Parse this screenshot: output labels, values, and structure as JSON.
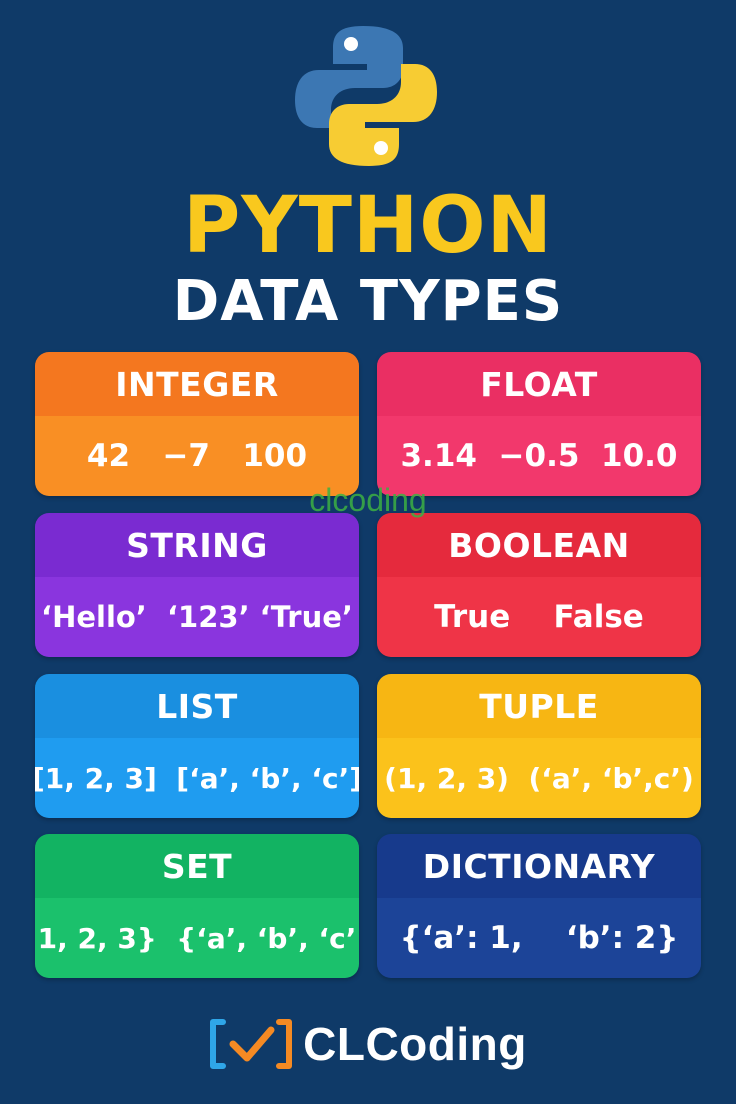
{
  "title": {
    "line1": "PYTHON",
    "line2": "DATA TYPES"
  },
  "watermark": "clcoding",
  "brand": {
    "name": "CLCoding"
  },
  "cards": [
    {
      "name": "INTEGER",
      "examples": "42   −7   100",
      "head_color": "#f4771f",
      "body_color": "#f98f24"
    },
    {
      "name": "FLOAT",
      "examples": "3.14  −0.5  10.0",
      "head_color": "#ea2f63",
      "body_color": "#f2386c"
    },
    {
      "name": "STRING",
      "examples": "‘Hello’  ‘123’ ‘True’",
      "head_color": "#7a2bd1",
      "body_color": "#8a35de"
    },
    {
      "name": "BOOLEAN",
      "examples": "True    False",
      "head_color": "#e52a3d",
      "body_color": "#ef3447"
    },
    {
      "name": "LIST",
      "examples": "[1, 2, 3]  [‘a’, ‘b’, ‘c’]",
      "head_color": "#1a8fe0",
      "body_color": "#1f9cf0"
    },
    {
      "name": "TUPLE",
      "examples": "(1, 2, 3)  (‘a’, ‘b’,c’)",
      "head_color": "#f7b613",
      "body_color": "#fbc21b"
    },
    {
      "name": "SET",
      "examples": "{1, 2, 3}  {‘a’, ‘b’, ‘c’}",
      "head_color": "#12b362",
      "body_color": "#1bc16c"
    },
    {
      "name": "DICTIONARY",
      "examples": "{‘a’: 1,    ‘b’: 2}",
      "head_color": "#173a8c",
      "body_color": "#1c4498"
    }
  ],
  "colors": {
    "background": "#0f3a68",
    "title_yellow": "#f9c81e",
    "python_blue": "#3c77b3",
    "python_yellow": "#f7cc33",
    "watermark_green": "#3cb043",
    "brand_cyan": "#2fa6e8",
    "brand_orange": "#f58a23"
  }
}
